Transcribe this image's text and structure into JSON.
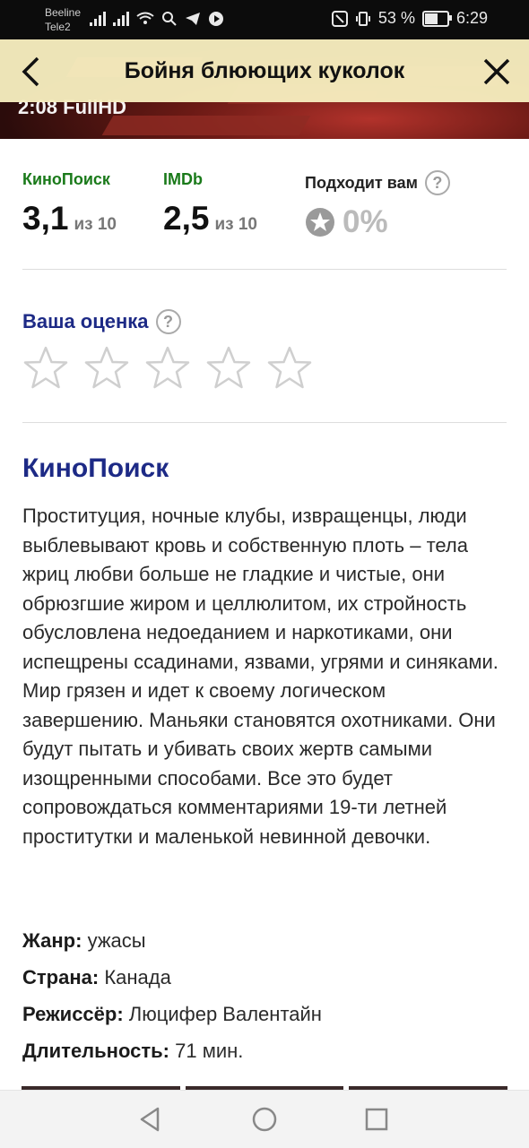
{
  "status_bar": {
    "carrier1": "Beeline",
    "carrier2": "Tele2",
    "battery": "53 %",
    "battery_level": 0.53,
    "time": "6:29"
  },
  "header": {
    "title": "Бойня блюющих куколок",
    "back_icon": "chevron-left-icon",
    "close_icon": "close-icon"
  },
  "hero": {
    "caption": "2:08 FullHD"
  },
  "ratings": {
    "kinopoisk": {
      "label": "КиноПоиск",
      "value": "3,1",
      "scale": "из 10",
      "color": "#1a7a1a"
    },
    "imdb": {
      "label": "IMDb",
      "value": "2,5",
      "scale": "из 10",
      "color": "#1a7a1a"
    },
    "fit": {
      "label": "Подходит вам",
      "value": "0%"
    }
  },
  "user_rating": {
    "label": "Ваша оценка",
    "stars": 5,
    "selected": 0
  },
  "description": {
    "source": "КиноПоиск",
    "text": "Проституция, ночные клубы, извращенцы, люди выблевывают кровь и собственную плоть – тела жриц любви больше не гладкие и чистые, они обрюзгшие жиром и целлюлитом, их стройность обусловлена недоеданием и наркотиками, они испещрены ссадинами, язвами, угрями и синяками. Мир грязен и идет к своему логическом завершению. Маньяки становятся охотниками. Они будут пытать и убивать своих жертв самыми изощренными способами. Все это будет сопровождаться комментариями 19-ти летней проститутки и маленькой невинной девочки."
  },
  "meta": {
    "genre_label": "Жанр:",
    "genre": "ужасы",
    "country_label": "Страна:",
    "country": "Канада",
    "director_label": "Режиссёр:",
    "director": "Люцифер Валентайн",
    "duration_label": "Длительность:",
    "duration": "71 мин."
  },
  "colors": {
    "header_bg": "#f6edbe",
    "accent_blue": "#1d2a86",
    "green": "#1a7a1a"
  }
}
